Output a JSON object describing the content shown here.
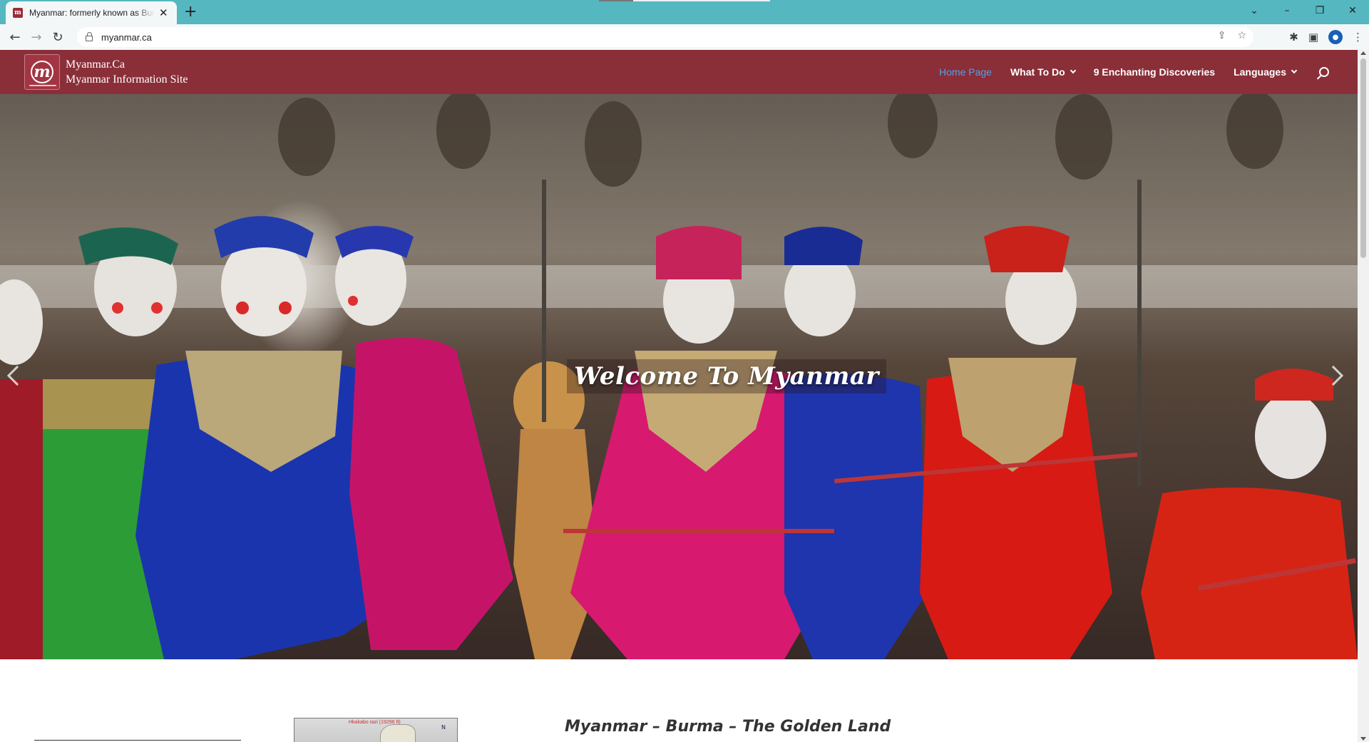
{
  "browser": {
    "tab_title": "Myanmar: formerly known as Burma",
    "favicon_letter": "m",
    "new_tab_label": "+",
    "url": "myanmar.ca",
    "window_controls": {
      "tab_search": "⌄",
      "minimize": "–",
      "restore": "❐",
      "close": "✕"
    }
  },
  "site": {
    "logo_letter": "m",
    "logo_line1": "Myanmar.Ca",
    "logo_line2": "Myanmar Information Site",
    "nav": [
      {
        "label": "Home Page",
        "active": true,
        "has_dropdown": false
      },
      {
        "label": "What To Do",
        "active": false,
        "has_dropdown": true
      },
      {
        "label": "9 Enchanting Discoveries",
        "active": false,
        "has_dropdown": false
      },
      {
        "label": "Languages",
        "active": false,
        "has_dropdown": true
      }
    ],
    "search_icon": "search-icon"
  },
  "hero": {
    "caption": "Welcome To Myanmar"
  },
  "content": {
    "heading": "Myanmar – Burma – The Golden Land",
    "map_label": "Hkakabo razi (19296 ft)",
    "map_compass": "N"
  },
  "colors": {
    "tabbar": "#55b7bf",
    "header": "#8a2e38",
    "nav_active": "#4fa3e8"
  }
}
